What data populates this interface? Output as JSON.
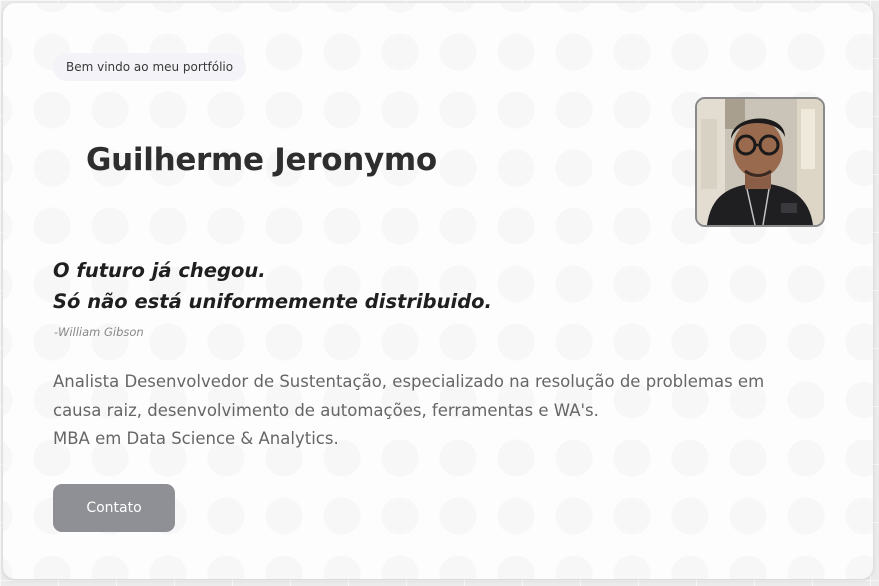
{
  "badge": "Bem vindo ao meu portfólio",
  "name": "Guilherme Jeronymo",
  "avatar_alt": "Guilherme Jeronymo",
  "quote": {
    "line1": "O futuro já chegou.",
    "line2": "Só não está uniformemente distribuido.",
    "author": "-William Gibson"
  },
  "bio": {
    "line1": "Analista Desenvolvedor de Sustentação, especializado na resolução de problemas em",
    "line2": "causa raiz, desenvolvimento de automações, ferramentas e WA's.",
    "line3": "MBA em Data Science & Analytics."
  },
  "contact_button": "Contato",
  "colors": {
    "card": "#fdfdfd",
    "button": "#8f9095",
    "title": "#2e2e2e"
  }
}
